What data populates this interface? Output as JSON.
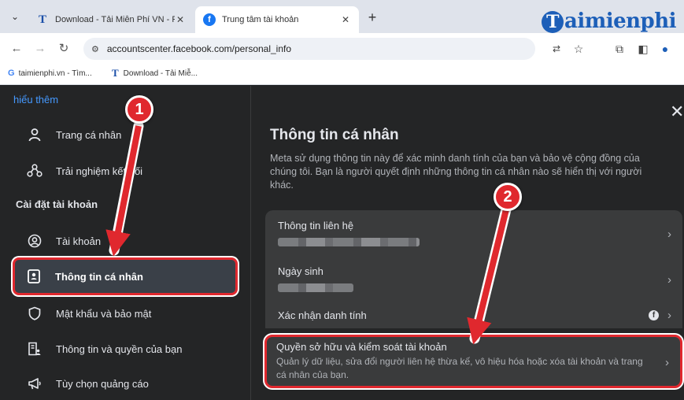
{
  "browser": {
    "tabs": [
      {
        "title": "Download - Tải Miễn Phí VN - Ph",
        "favicon": "T"
      },
      {
        "title": "Trung tâm tài khoản",
        "favicon": "f"
      }
    ],
    "url": "accountscenter.facebook.com/personal_info",
    "bookmarks": [
      {
        "label": "taimienphi.vn - Tìm...",
        "icon": "G"
      },
      {
        "label": "Download - Tải Miễ...",
        "icon": "T"
      }
    ],
    "watermark": "aimienphi"
  },
  "sidebar": {
    "learn_more": "hiểu thêm",
    "items_top": [
      {
        "label": "Trang cá nhân",
        "icon": "person-icon"
      },
      {
        "label": "Trải nghiệm kết nối",
        "icon": "connected-experience-icon"
      }
    ],
    "section_title": "Cài đặt tài khoản",
    "items": [
      {
        "label": "Tài khoản",
        "icon": "account-icon"
      },
      {
        "label": "Thông tin cá nhân",
        "icon": "id-card-icon",
        "active": true
      },
      {
        "label": "Mật khẩu và bảo mật",
        "icon": "shield-icon"
      },
      {
        "label": "Thông tin và quyền của bạn",
        "icon": "info-permissions-icon"
      },
      {
        "label": "Tùy chọn quảng cáo",
        "icon": "megaphone-icon"
      }
    ]
  },
  "main": {
    "title": "Thông tin cá nhân",
    "description": "Meta sử dụng thông tin này để xác minh danh tính của bạn và bảo vệ cộng đồng của chúng tôi. Bạn là người quyết định những thông tin cá nhân nào sẽ hiển thị với người khác.",
    "items": [
      {
        "label": "Thông tin liên hệ"
      },
      {
        "label": "Ngày sinh"
      },
      {
        "label": "Xác nhận danh tính"
      },
      {
        "label": "Quyền sở hữu và kiểm soát tài khoản",
        "sub": "Quản lý dữ liệu, sửa đổi người liên hệ thừa kế, vô hiệu hóa hoặc xóa tài khoản và trang cá nhân của bạn."
      }
    ]
  },
  "annotations": {
    "step1": "1",
    "step2": "2",
    "color": "#e0282e"
  }
}
